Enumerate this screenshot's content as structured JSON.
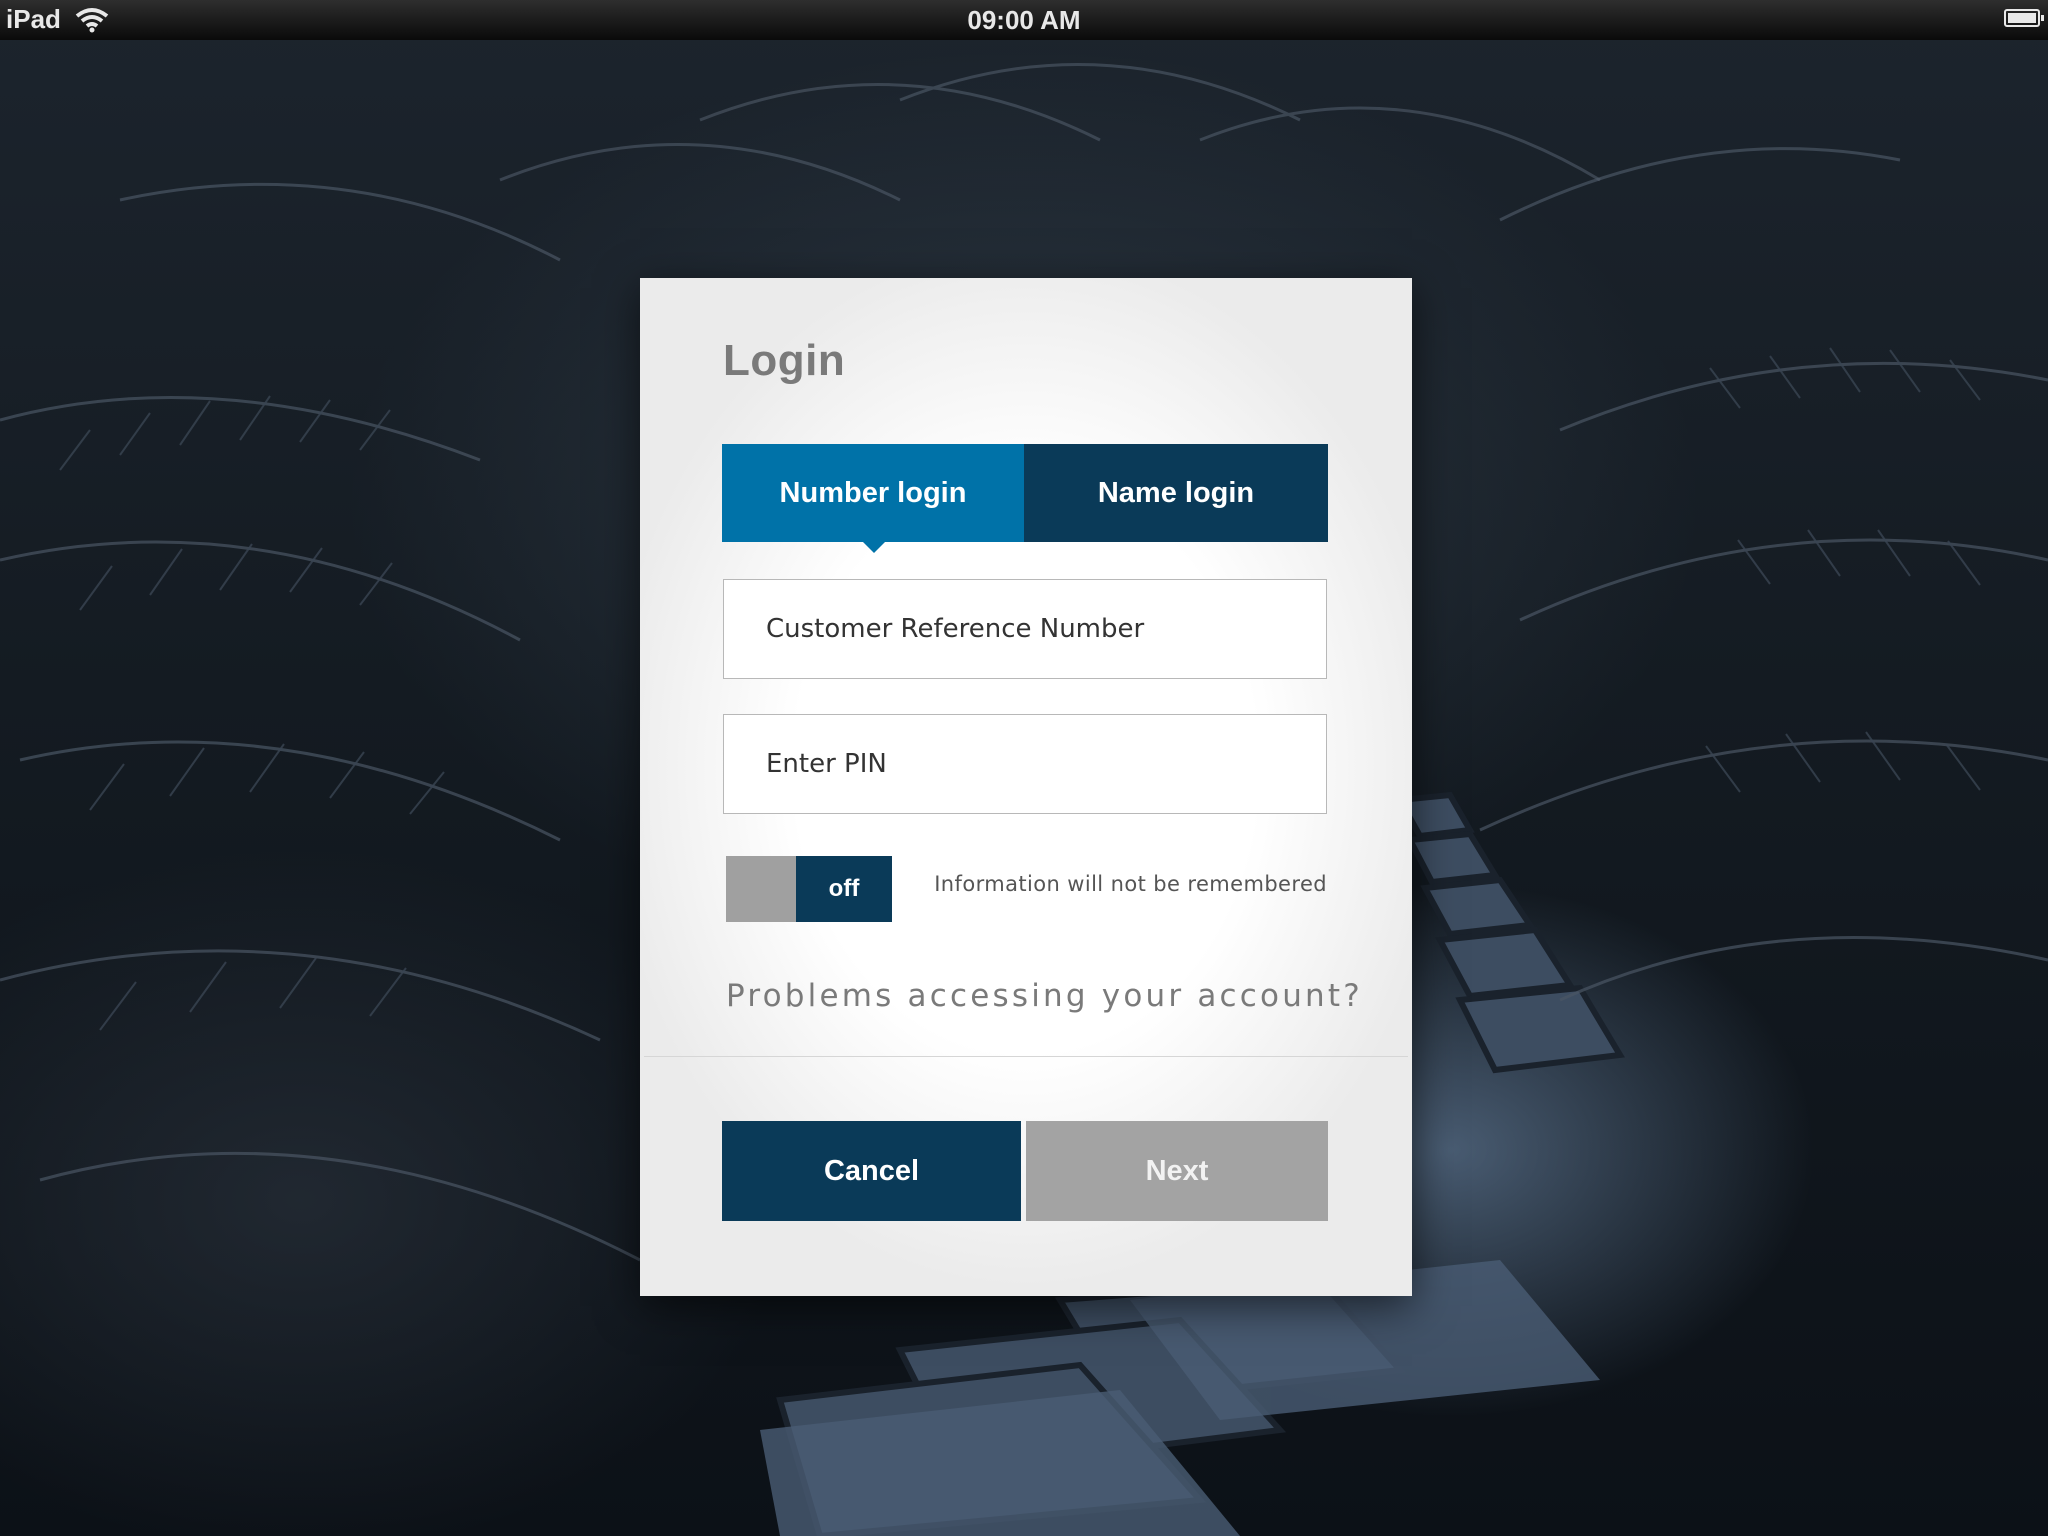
{
  "status_bar": {
    "device": "iPad",
    "time": "09:00 AM",
    "wifi_icon": "wifi-icon",
    "battery_icon": "battery-icon"
  },
  "dialog": {
    "title": "Login",
    "tabs": [
      {
        "label": "Number login",
        "active": true
      },
      {
        "label": "Name login",
        "active": false
      }
    ],
    "fields": {
      "customer_reference": {
        "placeholder": "Customer Reference Number",
        "value": ""
      },
      "pin": {
        "placeholder": "Enter PIN",
        "value": ""
      }
    },
    "remember": {
      "toggle_label": "off",
      "description": "Information will not be remembered"
    },
    "problems_link": "Problems accessing your account?",
    "buttons": {
      "cancel": "Cancel",
      "next": "Next"
    }
  },
  "colors": {
    "active_tab": "#0072a8",
    "dark_navy": "#0a3a58",
    "disabled_button": "#a3a3a3",
    "toggle_knob": "#a0a0a0"
  }
}
